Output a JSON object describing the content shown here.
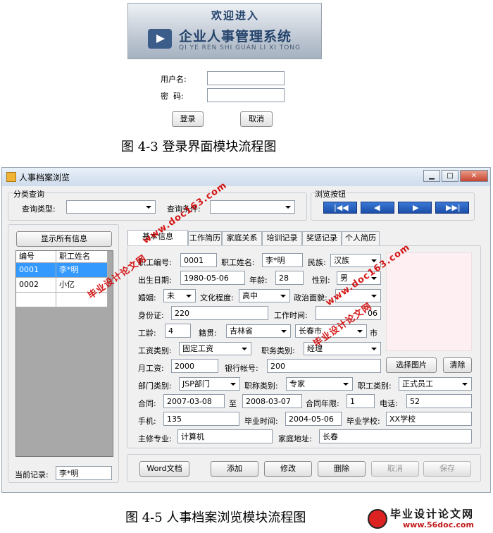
{
  "login": {
    "banner_welcome": "欢迎进入",
    "banner_title": "企业人事管理系统",
    "banner_pinyin": "QI YE REN SHI GUAN LI XI TONG",
    "username_label": "用户名:",
    "password_label": "密  码:",
    "login_button": "登录",
    "cancel_button": "取消",
    "caption": "图 4-3 登录界面模块流程图"
  },
  "window": {
    "title": "人事档案浏览",
    "query_group": "分类查询",
    "query_type_label": "查询类型:",
    "query_cond_label": "查询条件:",
    "browse_group": "浏览按钮",
    "show_all_button": "显示所有信息",
    "current_record_label": "当前记录:",
    "current_record_value": "李*明",
    "grid_headers": [
      "编号",
      "职工姓名"
    ],
    "grid_rows": [
      [
        "0001",
        "李*明"
      ],
      [
        "0002",
        "小亿"
      ]
    ],
    "tabs": [
      "基本信息",
      "工作简历",
      "家庭关系",
      "培训记录",
      "奖惩记录",
      "个人简历"
    ],
    "fields": {
      "emp_no_label": "职工编号:",
      "emp_no": "0001",
      "emp_name_label": "职工姓名:",
      "emp_name": "李*明",
      "nation_label": "民族:",
      "nation": "汉族",
      "birth_label": "出生日期:",
      "birth": "1980-05-06",
      "age_label": "年龄:",
      "age": "28",
      "gender_label": "性别:",
      "gender": "男",
      "marriage_label": "婚姻:",
      "marriage": "未",
      "education_label": "文化程度:",
      "education": "高中",
      "politics_label": "政治面貌:",
      "idcard_label": "身份证:",
      "idcard": "220",
      "worktime_label": "工作时间:",
      "worktime": "06",
      "seniority_label": "工龄:",
      "seniority": "4",
      "native_label": "籍贯:",
      "province": "吉林省",
      "city": "长春市",
      "city_suffix": "市",
      "salary_type_label": "工资类别:",
      "salary_type": "固定工资",
      "position_label": "职务类别:",
      "position": "经理",
      "monthly_label": "月工资:",
      "monthly": "2000",
      "bank_label": "银行帐号:",
      "bank": "200",
      "dept_label": "部门类别:",
      "dept": "JSP部门",
      "title_label": "职称类别:",
      "title": "专家",
      "emptype_label": "职工类别:",
      "emptype": "正式员工",
      "contract_label": "合同:",
      "contract_from": "2007-03-08",
      "to_label": "至",
      "contract_to": "2008-03-07",
      "contract_years_label": "合同年限:",
      "contract_years": "1",
      "phone_label": "电话:",
      "phone": "52",
      "mobile_label": "手机:",
      "mobile": "135",
      "grad_time_label": "毕业时间:",
      "grad_time": "2004-05-06",
      "school_label": "毕业学校:",
      "school": "XX学校",
      "major_label": "主修专业:",
      "major": "计算机",
      "address_label": "家庭地址:",
      "address": "长春"
    },
    "photo_select_button": "选择图片",
    "photo_clear_button": "清除",
    "buttons": {
      "word": "Word文档",
      "add": "添加",
      "modify": "修改",
      "delete": "删除",
      "cancel": "取消",
      "save": "保存"
    },
    "controls": {
      "minimize": "▁",
      "maximize": "□",
      "close": "✕"
    }
  },
  "watermarks": [
    "www.doc163.com",
    "毕业设计论文网"
  ],
  "caption2": "图 4-5 人事档案浏览模块流程图",
  "footer_logo": {
    "title": "毕业设计论文网",
    "url": "www.56doc.com"
  }
}
